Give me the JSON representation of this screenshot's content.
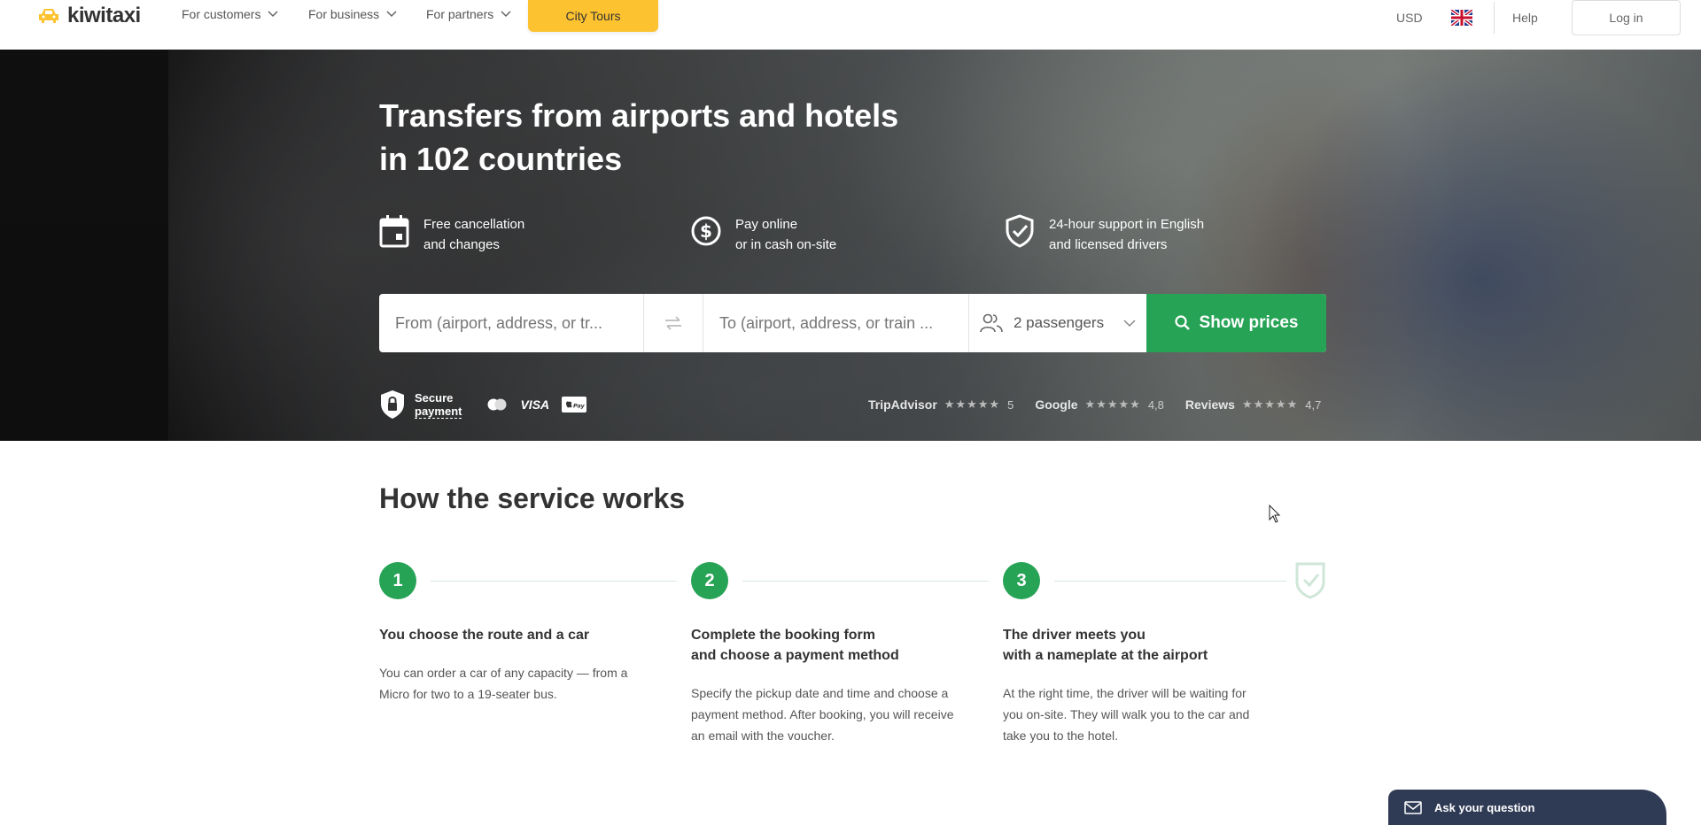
{
  "header": {
    "logo_text": "kiwitaxi",
    "nav": [
      {
        "label": "For customers"
      },
      {
        "label": "For business"
      },
      {
        "label": "For partners"
      }
    ],
    "city_tours": "City Tours",
    "currency": "USD",
    "help": "Help",
    "login": "Log in"
  },
  "hero": {
    "title_line1": "Transfers from airports and hotels",
    "title_line2": "in 102 countries",
    "features": [
      {
        "icon": "calendar-icon",
        "line1": "Free cancellation",
        "line2": "and changes"
      },
      {
        "icon": "dollar-coin-icon",
        "line1": "Pay online",
        "line2": "or in cash on-site"
      },
      {
        "icon": "shield-check-icon",
        "line1": "24-hour support in English",
        "line2": "and licensed drivers"
      }
    ],
    "search": {
      "from_placeholder": "From (airport, address, or tr...",
      "to_placeholder": "To (airport, address, or train ...",
      "passengers": "2 passengers",
      "show_prices": "Show prices"
    },
    "secure_line1": "Secure",
    "secure_line2": "payment",
    "payment_visa": "VISA",
    "payment_applepay": "Pay",
    "ratings": [
      {
        "source": "TripAdvisor",
        "stars": "★★★★★",
        "score": "5"
      },
      {
        "source": "Google",
        "stars": "★★★★★",
        "score": "4,8"
      },
      {
        "source": "Reviews",
        "stars": "★★★★★",
        "score": "4,7"
      }
    ]
  },
  "how": {
    "title": "How the service works",
    "steps": [
      {
        "num": "1",
        "title_line1": "You choose the route and a car",
        "title_line2": "",
        "text_line1": "You can order a car of any capacity — from a",
        "text_line2": "Micro for two to a 19-seater bus.",
        "text_line3": ""
      },
      {
        "num": "2",
        "title_line1": "Complete the booking form",
        "title_line2": "and choose a payment method",
        "text_line1": "Specify the pickup date and time and choose a",
        "text_line2": "payment method. After booking, you will receive",
        "text_line3": "an email with the voucher."
      },
      {
        "num": "3",
        "title_line1": "The driver meets you",
        "title_line2": "with a nameplate at the airport",
        "text_line1": "At the right time, the driver will be waiting for",
        "text_line2": "you on-site. They will walk you to the car and",
        "text_line3": "take you to the hotel."
      }
    ]
  },
  "chat": {
    "label": "Ask your question"
  },
  "colors": {
    "brand_yellow": "#fcc230",
    "accent_green": "#27a356",
    "chat_navy": "#2f3a55"
  }
}
